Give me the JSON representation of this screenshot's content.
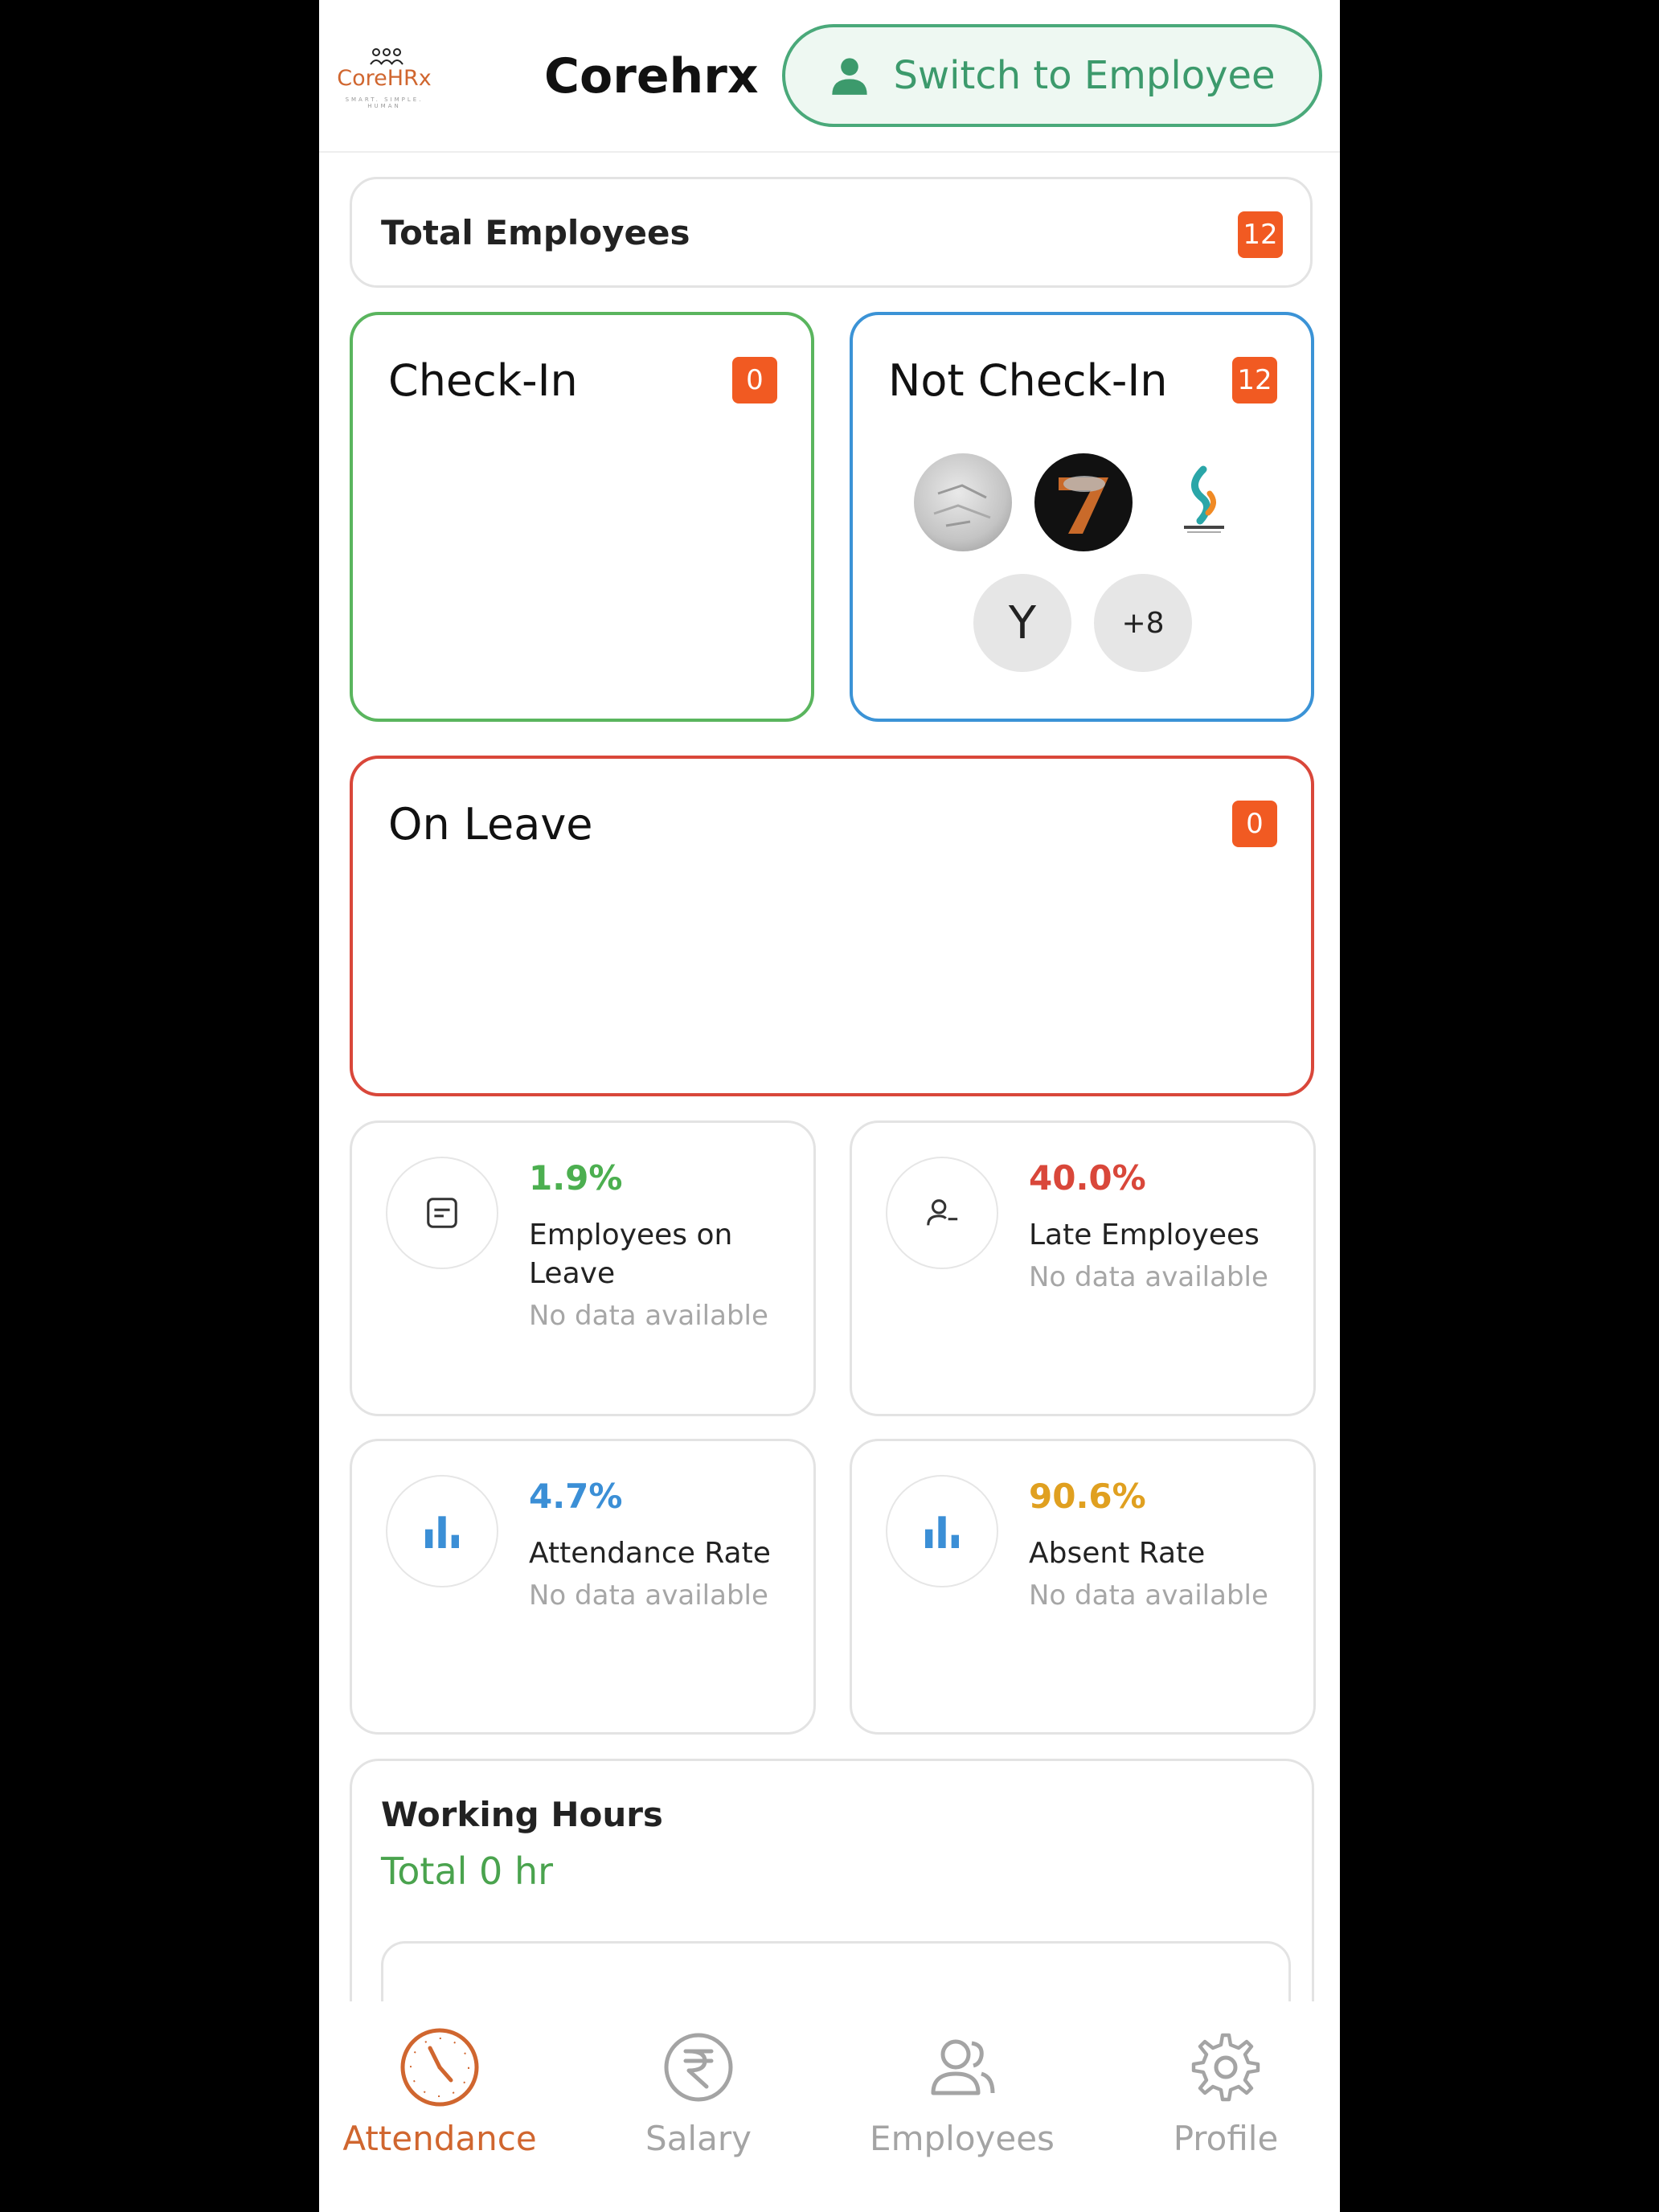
{
  "header": {
    "logo_text": "CoreHRx",
    "logo_tagline": "SMART. SIMPLE. HUMAN",
    "title": "Corehrx",
    "switch_label": "Switch to Employee"
  },
  "total_employees": {
    "label": "Total Employees",
    "count": "12"
  },
  "check_in": {
    "title": "Check-In",
    "count": "0"
  },
  "not_check_in": {
    "title": "Not Check-In",
    "count": "12",
    "initial": "Y",
    "more": "+8"
  },
  "on_leave": {
    "title": "On Leave",
    "count": "0"
  },
  "stats": [
    {
      "percent": "1.9%",
      "label": "Employees on Leave",
      "note": "No data available",
      "color": "#4caf50",
      "icon": "document-icon"
    },
    {
      "percent": "40.0%",
      "label": "Late Employees",
      "note": "No data available",
      "color": "#d9473a",
      "icon": "user-minus-icon"
    },
    {
      "percent": "4.7%",
      "label": "Attendance Rate",
      "note": "No data available",
      "color": "#3b8fd6",
      "icon": "bar-chart-icon"
    },
    {
      "percent": "90.6%",
      "label": "Absent Rate",
      "note": "No data available",
      "color": "#e0a020",
      "icon": "bar-chart-icon"
    }
  ],
  "working_hours": {
    "title": "Working Hours",
    "total": "Total 0 hr"
  },
  "nav": [
    {
      "label": "Attendance",
      "icon": "clock-icon",
      "active": true
    },
    {
      "label": "Salary",
      "icon": "rupee-icon",
      "active": false
    },
    {
      "label": "Employees",
      "icon": "users-icon",
      "active": false
    },
    {
      "label": "Profile",
      "icon": "gear-icon",
      "active": false
    }
  ],
  "colors": {
    "accent": "#d0662f",
    "green": "#4aa97a",
    "badge": "#f15a22"
  }
}
